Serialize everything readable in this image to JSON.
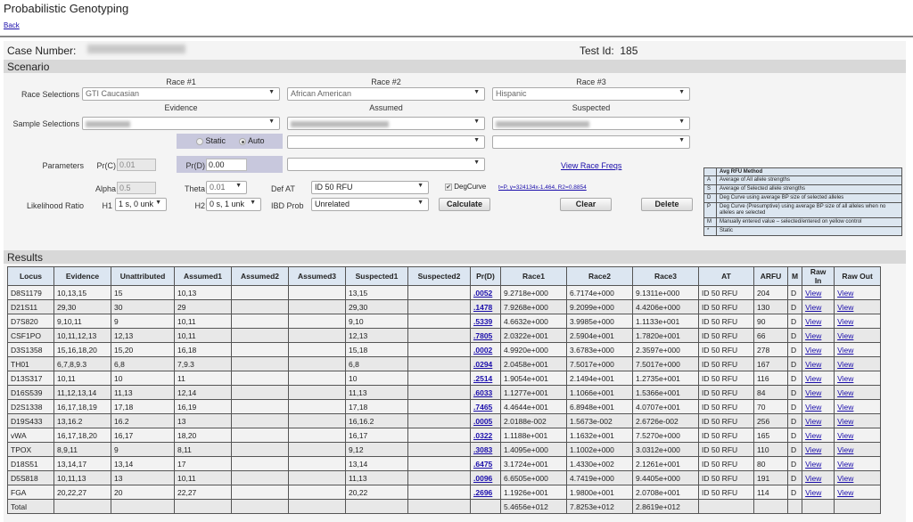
{
  "app": {
    "title": "Probabilistic Genotyping",
    "back_label": "Back"
  },
  "case": {
    "case_number_label": "Case Number:",
    "test_id_label": "Test Id:",
    "test_id_value": "185"
  },
  "scenario": {
    "section_title": "Scenario",
    "race_headers": [
      "Race #1",
      "Race #2",
      "Race #3"
    ],
    "race_selections_label": "Race Selections",
    "race_values": [
      "GTI Caucasian",
      "African American",
      "Hispanic"
    ],
    "sample_headers": [
      "Evidence",
      "Assumed",
      "Suspected"
    ],
    "sample_selections_label": "Sample Selections",
    "static_label": "Static",
    "auto_label": "Auto",
    "mode_selected": "Auto",
    "parameters_label": "Parameters",
    "prc_label": "Pr(C)",
    "prc_value": "0.01",
    "prd_label": "Pr(D)",
    "prd_value": "0.00",
    "view_race_freqs": "View Race Freqs",
    "alpha_label": "Alpha",
    "alpha_value": "0.5",
    "theta_label": "Theta",
    "theta_value": "0.01",
    "def_at_label": "Def AT",
    "def_at_value": "ID 50 RFU",
    "degcurve_label": "DegCurve",
    "degcurve_checked": true,
    "degcurve_formula": "t=P, y=324134x-1.464, R2=0.8854",
    "lr_label": "Likelihood Ratio",
    "h1_label": "H1",
    "h1_value": "1 s, 0 unk",
    "h2_label": "H2",
    "h2_value": "0 s, 1 unk",
    "ibd_label": "IBD Prob",
    "ibd_value": "Unrelated",
    "calculate_label": "Calculate",
    "clear_label": "Clear",
    "delete_label": "Delete"
  },
  "legend": {
    "title": "Avg RFU Method",
    "rows": [
      {
        "key": "A",
        "text": "Average of All allele strengths"
      },
      {
        "key": "S",
        "text": "Average of Selected allele strengths"
      },
      {
        "key": "D",
        "text": "Deg Curve using average BP size of selected alleles"
      },
      {
        "key": "P",
        "text": "Deg Curve (Presumptive) using average BP size of all alleles when no alleles are selected"
      },
      {
        "key": "M",
        "text": "Manually entered value – selected/entered on yellow control"
      },
      {
        "key": "*",
        "text": "Static"
      }
    ]
  },
  "results": {
    "section_title": "Results",
    "columns": [
      "Locus",
      "Evidence",
      "Unattributed",
      "Assumed1",
      "Assumed2",
      "Assumed3",
      "Suspected1",
      "Suspected2",
      "Pr(D)",
      "Race1",
      "Race2",
      "Race3",
      "AT",
      "ARFU",
      "M",
      "Raw In",
      "Raw Out"
    ],
    "view_label": "View",
    "rows": [
      {
        "locus": "D8S1179",
        "evidence": "10,13,15",
        "unattributed": "15",
        "assumed1": "10,13",
        "assumed2": "",
        "assumed3": "",
        "suspected1": "13,15",
        "suspected2": "",
        "prd": ".0052",
        "race1": "9.2718e+000",
        "race2": "6.7174e+000",
        "race3": "9.1311e+000",
        "at": "ID 50 RFU",
        "arfu": "204",
        "m": "D"
      },
      {
        "locus": "D21S11",
        "evidence": "29,30",
        "unattributed": "30",
        "assumed1": "29",
        "assumed2": "",
        "assumed3": "",
        "suspected1": "29,30",
        "suspected2": "",
        "prd": ".1478",
        "race1": "7.9268e+000",
        "race2": "9.2099e+000",
        "race3": "4.4206e+000",
        "at": "ID 50 RFU",
        "arfu": "130",
        "m": "D"
      },
      {
        "locus": "D7S820",
        "evidence": "9,10,11",
        "unattributed": "9",
        "assumed1": "10,11",
        "assumed2": "",
        "assumed3": "",
        "suspected1": "9,10",
        "suspected2": "",
        "prd": ".5339",
        "race1": "4.6632e+000",
        "race2": "3.9985e+000",
        "race3": "1.1133e+001",
        "at": "ID 50 RFU",
        "arfu": "90",
        "m": "D"
      },
      {
        "locus": "CSF1PO",
        "evidence": "10,11,12,13",
        "unattributed": "12,13",
        "assumed1": "10,11",
        "assumed2": "",
        "assumed3": "",
        "suspected1": "12,13",
        "suspected2": "",
        "prd": ".7805",
        "race1": "2.0322e+001",
        "race2": "2.5904e+001",
        "race3": "1.7820e+001",
        "at": "ID 50 RFU",
        "arfu": "66",
        "m": "D"
      },
      {
        "locus": "D3S1358",
        "evidence": "15,16,18,20",
        "unattributed": "15,20",
        "assumed1": "16,18",
        "assumed2": "",
        "assumed3": "",
        "suspected1": "15,18",
        "suspected2": "",
        "prd": ".0002",
        "race1": "4.9920e+000",
        "race2": "3.6783e+000",
        "race3": "2.3597e+000",
        "at": "ID 50 RFU",
        "arfu": "278",
        "m": "D"
      },
      {
        "locus": "TH01",
        "evidence": "6,7,8,9.3",
        "unattributed": "6,8",
        "assumed1": "7,9.3",
        "assumed2": "",
        "assumed3": "",
        "suspected1": "6,8",
        "suspected2": "",
        "prd": ".0294",
        "race1": "2.0458e+001",
        "race2": "7.5017e+000",
        "race3": "7.5017e+000",
        "at": "ID 50 RFU",
        "arfu": "167",
        "m": "D"
      },
      {
        "locus": "D13S317",
        "evidence": "10,11",
        "unattributed": "10",
        "assumed1": "11",
        "assumed2": "",
        "assumed3": "",
        "suspected1": "10",
        "suspected2": "",
        "prd": ".2514",
        "race1": "1.9054e+001",
        "race2": "2.1494e+001",
        "race3": "1.2735e+001",
        "at": "ID 50 RFU",
        "arfu": "116",
        "m": "D"
      },
      {
        "locus": "D16S539",
        "evidence": "11,12,13,14",
        "unattributed": "11,13",
        "assumed1": "12,14",
        "assumed2": "",
        "assumed3": "",
        "suspected1": "11,13",
        "suspected2": "",
        "prd": ".6033",
        "race1": "1.1277e+001",
        "race2": "1.1066e+001",
        "race3": "1.5366e+001",
        "at": "ID 50 RFU",
        "arfu": "84",
        "m": "D"
      },
      {
        "locus": "D2S1338",
        "evidence": "16,17,18,19",
        "unattributed": "17,18",
        "assumed1": "16,19",
        "assumed2": "",
        "assumed3": "",
        "suspected1": "17,18",
        "suspected2": "",
        "prd": ".7465",
        "race1": "4.4644e+001",
        "race2": "6.8948e+001",
        "race3": "4.0707e+001",
        "at": "ID 50 RFU",
        "arfu": "70",
        "m": "D"
      },
      {
        "locus": "D19S433",
        "evidence": "13,16.2",
        "unattributed": "16.2",
        "assumed1": "13",
        "assumed2": "",
        "assumed3": "",
        "suspected1": "16,16.2",
        "suspected2": "",
        "prd": ".0005",
        "race1": "2.0188e-002",
        "race2": "1.5673e-002",
        "race3": "2.6726e-002",
        "at": "ID 50 RFU",
        "arfu": "256",
        "m": "D"
      },
      {
        "locus": "vWA",
        "evidence": "16,17,18,20",
        "unattributed": "16,17",
        "assumed1": "18,20",
        "assumed2": "",
        "assumed3": "",
        "suspected1": "16,17",
        "suspected2": "",
        "prd": ".0322",
        "race1": "1.1188e+001",
        "race2": "1.1632e+001",
        "race3": "7.5270e+000",
        "at": "ID 50 RFU",
        "arfu": "165",
        "m": "D"
      },
      {
        "locus": "TPOX",
        "evidence": "8,9,11",
        "unattributed": "9",
        "assumed1": "8,11",
        "assumed2": "",
        "assumed3": "",
        "suspected1": "9,12",
        "suspected2": "",
        "prd": ".3083",
        "race1": "1.4095e+000",
        "race2": "1.1002e+000",
        "race3": "3.0312e+000",
        "at": "ID 50 RFU",
        "arfu": "110",
        "m": "D"
      },
      {
        "locus": "D18S51",
        "evidence": "13,14,17",
        "unattributed": "13,14",
        "assumed1": "17",
        "assumed2": "",
        "assumed3": "",
        "suspected1": "13,14",
        "suspected2": "",
        "prd": ".6475",
        "race1": "3.1724e+001",
        "race2": "1.4330e+002",
        "race3": "2.1261e+001",
        "at": "ID 50 RFU",
        "arfu": "80",
        "m": "D"
      },
      {
        "locus": "D5S818",
        "evidence": "10,11,13",
        "unattributed": "13",
        "assumed1": "10,11",
        "assumed2": "",
        "assumed3": "",
        "suspected1": "11,13",
        "suspected2": "",
        "prd": ".0096",
        "race1": "6.6505e+000",
        "race2": "4.7419e+000",
        "race3": "9.4405e+000",
        "at": "ID 50 RFU",
        "arfu": "191",
        "m": "D"
      },
      {
        "locus": "FGA",
        "evidence": "20,22,27",
        "unattributed": "20",
        "assumed1": "22,27",
        "assumed2": "",
        "assumed3": "",
        "suspected1": "20,22",
        "suspected2": "",
        "prd": ".2696",
        "race1": "1.1926e+001",
        "race2": "1.9800e+001",
        "race3": "2.0708e+001",
        "at": "ID 50 RFU",
        "arfu": "114",
        "m": "D"
      }
    ],
    "total": {
      "label": "Total",
      "race1": "5.4656e+012",
      "race2": "7.8253e+012",
      "race3": "2.8619e+012"
    }
  }
}
